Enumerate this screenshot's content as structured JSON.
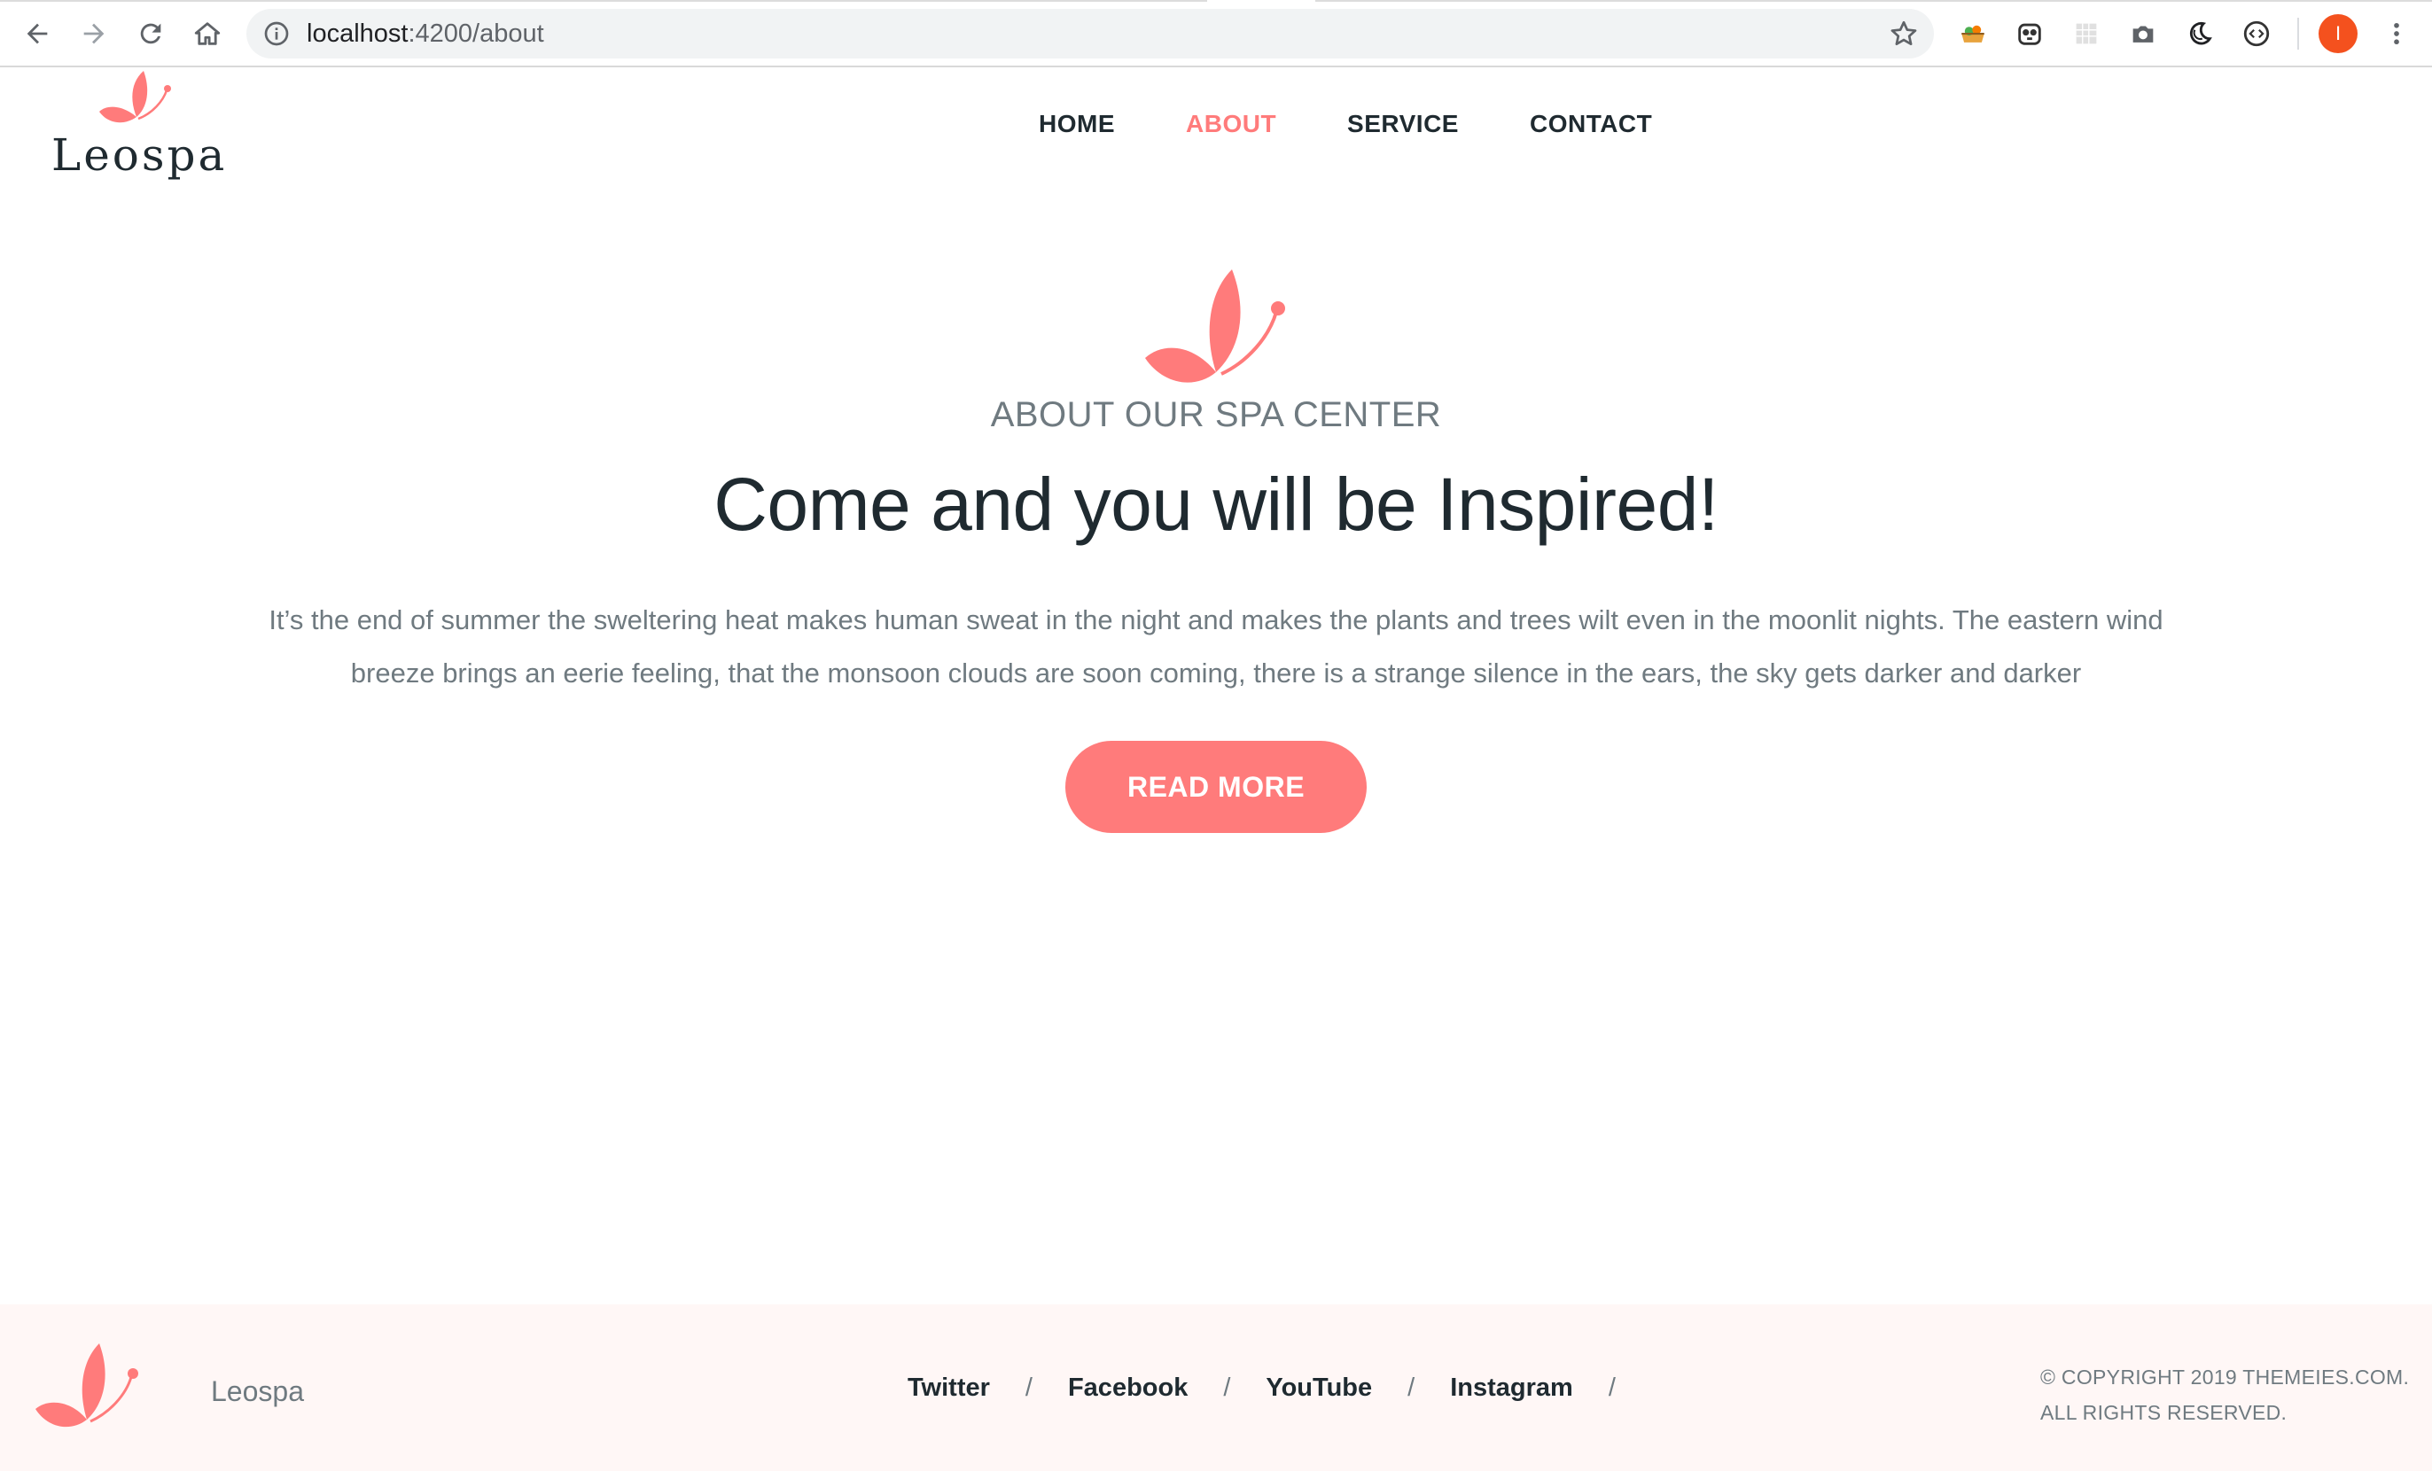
{
  "browser": {
    "url_host": "localhost",
    "url_path": ":4200/about",
    "profile_initial": "I",
    "icons": [
      "back-arrow-icon",
      "forward-arrow-icon",
      "reload-icon",
      "home-icon",
      "info-icon",
      "star-icon",
      "extension-icon",
      "menu-kebab-icon"
    ]
  },
  "header": {
    "logo_text": "Leospa",
    "nav": [
      {
        "label": "HOME",
        "active": false
      },
      {
        "label": "ABOUT",
        "active": true
      },
      {
        "label": "SERVICE",
        "active": false
      },
      {
        "label": "CONTACT",
        "active": false
      }
    ]
  },
  "about": {
    "eyebrow": "ABOUT OUR SPA CENTER",
    "headline": "Come and you will be Inspired!",
    "body": "It’s the end of summer the sweltering heat makes human sweat in the night and makes the plants and trees wilt even in the moonlit nights. The eastern wind breeze brings an eerie feeling, that the monsoon clouds are soon coming, there is a strange silence in the ears, the sky gets darker and darker",
    "cta_label": "READ MORE"
  },
  "footer": {
    "brand": "Leospa",
    "social": [
      "Twitter",
      "Facebook",
      "YouTube",
      "Instagram"
    ],
    "separator": "/",
    "copyright_line1": "© COPYRIGHT 2019 THEMEIES.COM.",
    "copyright_line2": "ALL RIGHTS RESERVED."
  },
  "colors": {
    "accent": "#ff7b7b",
    "text_dark": "#1f2a30",
    "text_muted": "#6f7a80",
    "footer_bg": "#fff7f6"
  }
}
